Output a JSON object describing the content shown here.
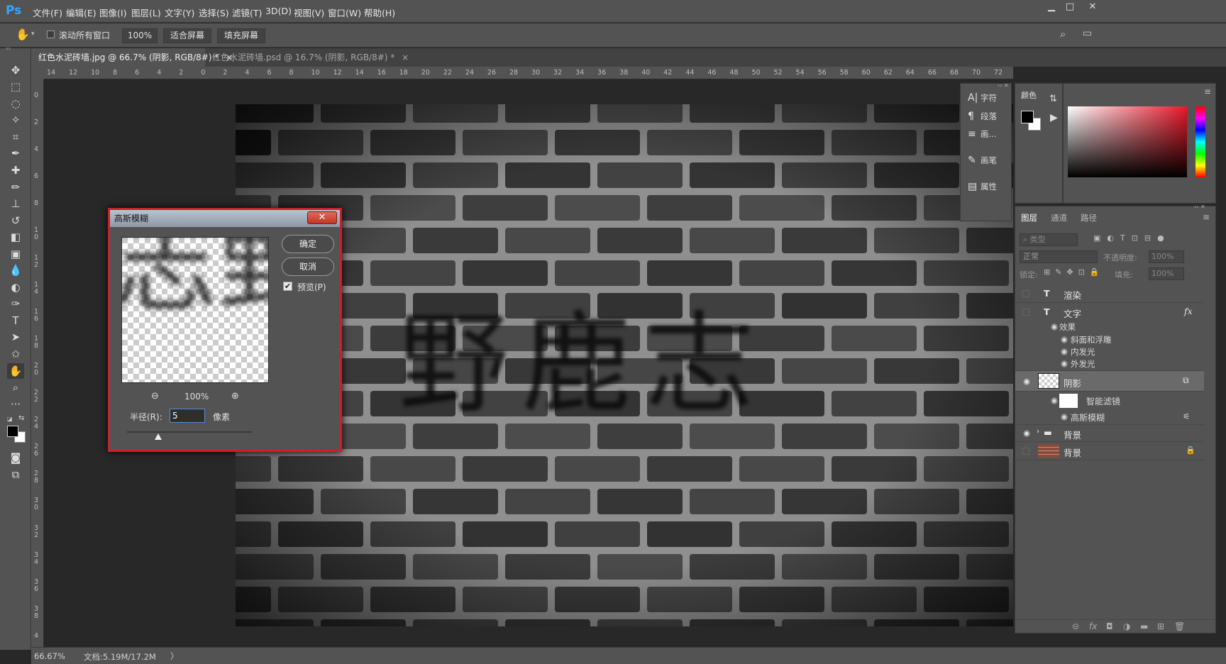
{
  "app": {
    "logo": "Ps"
  },
  "menu": [
    "文件(F)",
    "编辑(E)",
    "图像(I)",
    "图层(L)",
    "文字(Y)",
    "选择(S)",
    "滤镜(T)",
    "3D(D)",
    "视图(V)",
    "窗口(W)",
    "帮助(H)"
  ],
  "window_controls": {
    "minimize": "▁",
    "restore": "□",
    "close": "✕"
  },
  "options_bar": {
    "scroll_all_label": "滚动所有窗口",
    "scroll_all_checked": false,
    "zoom_btn": "100%",
    "fit_screen_btn": "适合屏幕",
    "fill_screen_btn": "填充屏幕"
  },
  "tabs": [
    {
      "title": "红色水泥砖墙.jpg @ 66.7% (阴影, RGB/8#) *",
      "close": "×",
      "active": true
    },
    {
      "title": "红色水泥砖墙.psd @ 16.7% (阴影, RGB/8#) *",
      "close": "×",
      "active": false
    }
  ],
  "ruler_h": [
    "14",
    "12",
    "10",
    "8",
    "6",
    "4",
    "2",
    "0",
    "2",
    "4",
    "6",
    "8",
    "10",
    "12",
    "14",
    "16",
    "18",
    "20",
    "22",
    "24",
    "26",
    "28",
    "30",
    "32",
    "34",
    "36",
    "38",
    "40",
    "42",
    "44",
    "46",
    "48",
    "50",
    "52",
    "54",
    "56",
    "58",
    "60",
    "62",
    "64",
    "66",
    "68",
    "70",
    "72"
  ],
  "ruler_v": [
    "0",
    "2",
    "4",
    "6",
    "8",
    "1 0",
    "1 2",
    "1 4",
    "1 6",
    "1 8",
    "2 0",
    "2 2",
    "2 4",
    "2 6",
    "2 8",
    "3 0",
    "3 2",
    "3 4",
    "3 6",
    "3 8",
    "4"
  ],
  "canvas": {
    "overlay_text": "野鹿志"
  },
  "status": {
    "zoom": "66.67%",
    "doc_info": "文档:5.19M/17.2M",
    "arrow": "〉"
  },
  "dialog": {
    "title": "高斯模糊",
    "close": "✕",
    "ok": "确定",
    "cancel": "取消",
    "preview_label": "预览(P)",
    "preview_checked": true,
    "preview_glyphs": "志野",
    "zoom_value": "100%",
    "radius_label": "半径(R):",
    "radius_value": "5",
    "radius_unit": "像素",
    "zoom_out": "⊖",
    "zoom_in": "⊕"
  },
  "mini_panels": [
    {
      "icon": "A|",
      "label": "字符"
    },
    {
      "icon": "¶",
      "label": "段落"
    },
    {
      "icon": "≡",
      "label": "画..."
    },
    {
      "icon": "✎",
      "label": "画笔"
    },
    {
      "icon": "▤",
      "label": "属性"
    }
  ],
  "color_panel": {
    "tab": "颜色",
    "fg_color": "#000000",
    "bg_color": "#ffffff",
    "hue_color": "#e8182a"
  },
  "layers_panel": {
    "tabs": [
      "图层",
      "通道",
      "路径"
    ],
    "filter_placeholder": "类型",
    "blend_mode": "正常",
    "opacity_label": "不透明度:",
    "opacity_value": "100%",
    "lock_label": "锁定:",
    "fill_label": "填充:",
    "fill_value": "100%",
    "layers": [
      {
        "name": "渲染",
        "kind": "T",
        "visible": false
      },
      {
        "name": "文字",
        "kind": "T",
        "visible": false,
        "fx": "fx",
        "effects_label": "效果",
        "effects": [
          "斜面和浮雕",
          "内发光",
          "外发光"
        ]
      },
      {
        "name": "阴影",
        "kind": "smart",
        "visible": true,
        "selected": true,
        "smart_filters_label": "智能滤镜",
        "filters": [
          "高斯模糊"
        ]
      },
      {
        "name": "背景",
        "kind": "group",
        "visible": true
      },
      {
        "name": "背景",
        "kind": "bg",
        "visible": false
      }
    ],
    "footer_icons": [
      "⊝",
      "fx",
      "◘",
      "◑",
      "▬",
      "⊞",
      "🗑"
    ]
  }
}
